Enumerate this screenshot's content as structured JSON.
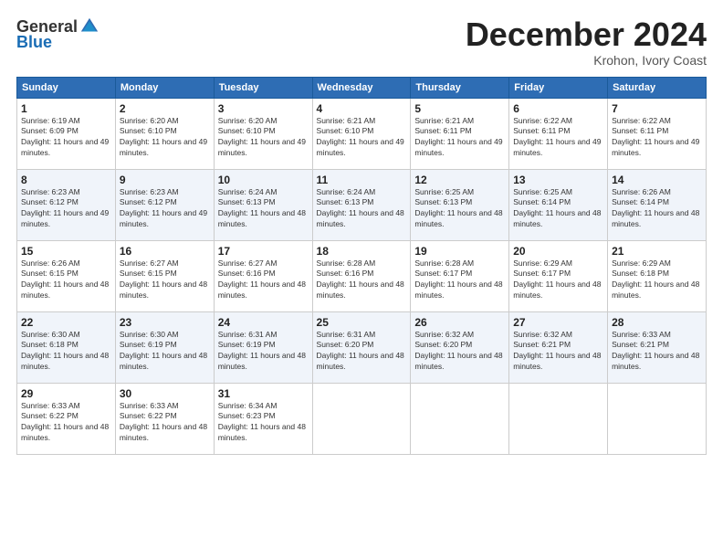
{
  "logo": {
    "general": "General",
    "blue": "Blue"
  },
  "title": {
    "month_year": "December 2024",
    "location": "Krohon, Ivory Coast"
  },
  "weekdays": [
    "Sunday",
    "Monday",
    "Tuesday",
    "Wednesday",
    "Thursday",
    "Friday",
    "Saturday"
  ],
  "weeks": [
    [
      {
        "day": "1",
        "sunrise": "6:19 AM",
        "sunset": "6:09 PM",
        "daylight": "11 hours and 49 minutes."
      },
      {
        "day": "2",
        "sunrise": "6:20 AM",
        "sunset": "6:10 PM",
        "daylight": "11 hours and 49 minutes."
      },
      {
        "day": "3",
        "sunrise": "6:20 AM",
        "sunset": "6:10 PM",
        "daylight": "11 hours and 49 minutes."
      },
      {
        "day": "4",
        "sunrise": "6:21 AM",
        "sunset": "6:10 PM",
        "daylight": "11 hours and 49 minutes."
      },
      {
        "day": "5",
        "sunrise": "6:21 AM",
        "sunset": "6:11 PM",
        "daylight": "11 hours and 49 minutes."
      },
      {
        "day": "6",
        "sunrise": "6:22 AM",
        "sunset": "6:11 PM",
        "daylight": "11 hours and 49 minutes."
      },
      {
        "day": "7",
        "sunrise": "6:22 AM",
        "sunset": "6:11 PM",
        "daylight": "11 hours and 49 minutes."
      }
    ],
    [
      {
        "day": "8",
        "sunrise": "6:23 AM",
        "sunset": "6:12 PM",
        "daylight": "11 hours and 49 minutes."
      },
      {
        "day": "9",
        "sunrise": "6:23 AM",
        "sunset": "6:12 PM",
        "daylight": "11 hours and 49 minutes."
      },
      {
        "day": "10",
        "sunrise": "6:24 AM",
        "sunset": "6:13 PM",
        "daylight": "11 hours and 48 minutes."
      },
      {
        "day": "11",
        "sunrise": "6:24 AM",
        "sunset": "6:13 PM",
        "daylight": "11 hours and 48 minutes."
      },
      {
        "day": "12",
        "sunrise": "6:25 AM",
        "sunset": "6:13 PM",
        "daylight": "11 hours and 48 minutes."
      },
      {
        "day": "13",
        "sunrise": "6:25 AM",
        "sunset": "6:14 PM",
        "daylight": "11 hours and 48 minutes."
      },
      {
        "day": "14",
        "sunrise": "6:26 AM",
        "sunset": "6:14 PM",
        "daylight": "11 hours and 48 minutes."
      }
    ],
    [
      {
        "day": "15",
        "sunrise": "6:26 AM",
        "sunset": "6:15 PM",
        "daylight": "11 hours and 48 minutes."
      },
      {
        "day": "16",
        "sunrise": "6:27 AM",
        "sunset": "6:15 PM",
        "daylight": "11 hours and 48 minutes."
      },
      {
        "day": "17",
        "sunrise": "6:27 AM",
        "sunset": "6:16 PM",
        "daylight": "11 hours and 48 minutes."
      },
      {
        "day": "18",
        "sunrise": "6:28 AM",
        "sunset": "6:16 PM",
        "daylight": "11 hours and 48 minutes."
      },
      {
        "day": "19",
        "sunrise": "6:28 AM",
        "sunset": "6:17 PM",
        "daylight": "11 hours and 48 minutes."
      },
      {
        "day": "20",
        "sunrise": "6:29 AM",
        "sunset": "6:17 PM",
        "daylight": "11 hours and 48 minutes."
      },
      {
        "day": "21",
        "sunrise": "6:29 AM",
        "sunset": "6:18 PM",
        "daylight": "11 hours and 48 minutes."
      }
    ],
    [
      {
        "day": "22",
        "sunrise": "6:30 AM",
        "sunset": "6:18 PM",
        "daylight": "11 hours and 48 minutes."
      },
      {
        "day": "23",
        "sunrise": "6:30 AM",
        "sunset": "6:19 PM",
        "daylight": "11 hours and 48 minutes."
      },
      {
        "day": "24",
        "sunrise": "6:31 AM",
        "sunset": "6:19 PM",
        "daylight": "11 hours and 48 minutes."
      },
      {
        "day": "25",
        "sunrise": "6:31 AM",
        "sunset": "6:20 PM",
        "daylight": "11 hours and 48 minutes."
      },
      {
        "day": "26",
        "sunrise": "6:32 AM",
        "sunset": "6:20 PM",
        "daylight": "11 hours and 48 minutes."
      },
      {
        "day": "27",
        "sunrise": "6:32 AM",
        "sunset": "6:21 PM",
        "daylight": "11 hours and 48 minutes."
      },
      {
        "day": "28",
        "sunrise": "6:33 AM",
        "sunset": "6:21 PM",
        "daylight": "11 hours and 48 minutes."
      }
    ],
    [
      {
        "day": "29",
        "sunrise": "6:33 AM",
        "sunset": "6:22 PM",
        "daylight": "11 hours and 48 minutes."
      },
      {
        "day": "30",
        "sunrise": "6:33 AM",
        "sunset": "6:22 PM",
        "daylight": "11 hours and 48 minutes."
      },
      {
        "day": "31",
        "sunrise": "6:34 AM",
        "sunset": "6:23 PM",
        "daylight": "11 hours and 48 minutes."
      },
      null,
      null,
      null,
      null
    ]
  ],
  "labels": {
    "sunrise": "Sunrise: ",
    "sunset": "Sunset: ",
    "daylight": "Daylight: "
  }
}
